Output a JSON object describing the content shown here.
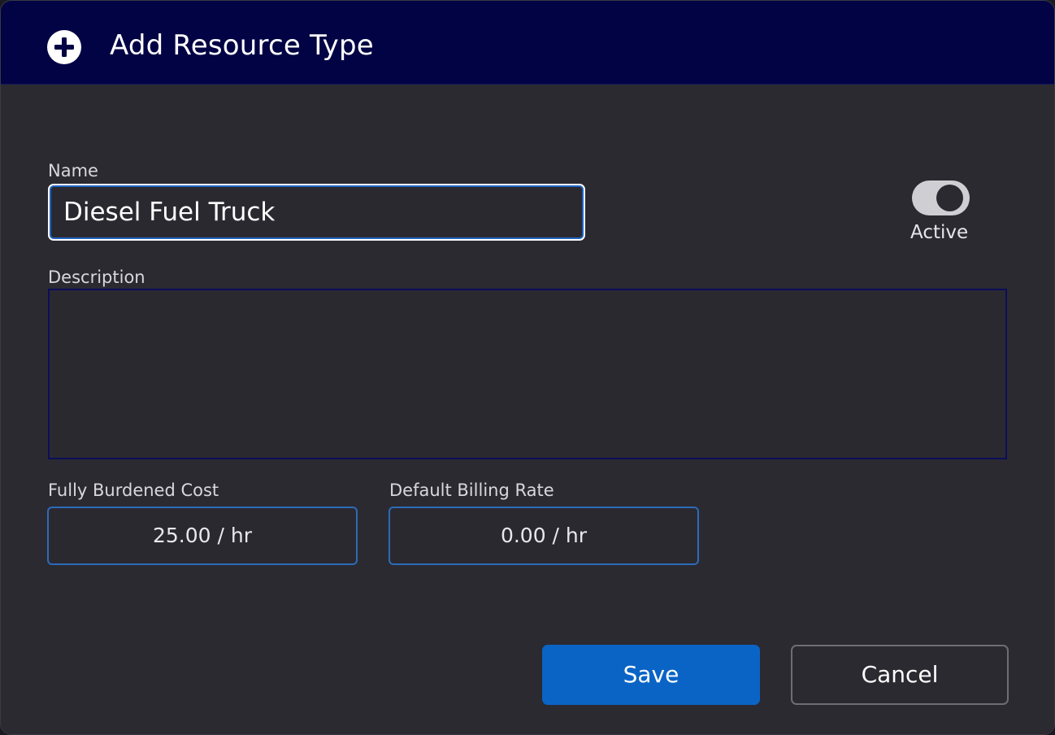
{
  "dialog": {
    "title": "Add Resource Type",
    "title_icon": "plus-circle-icon"
  },
  "form": {
    "name_label": "Name",
    "name_value": "Diesel Fuel Truck",
    "active_label": "Active",
    "active_on": true,
    "description_label": "Description",
    "description_value": "",
    "cost_label": "Fully Burdened Cost",
    "cost_value": "25.00 / hr",
    "billing_label": "Default Billing Rate",
    "billing_value": "0.00 / hr"
  },
  "buttons": {
    "save_label": "Save",
    "cancel_label": "Cancel"
  },
  "colors": {
    "header_bg": "#020344",
    "body_bg": "#2b2a31",
    "accent": "#0a64c5"
  }
}
